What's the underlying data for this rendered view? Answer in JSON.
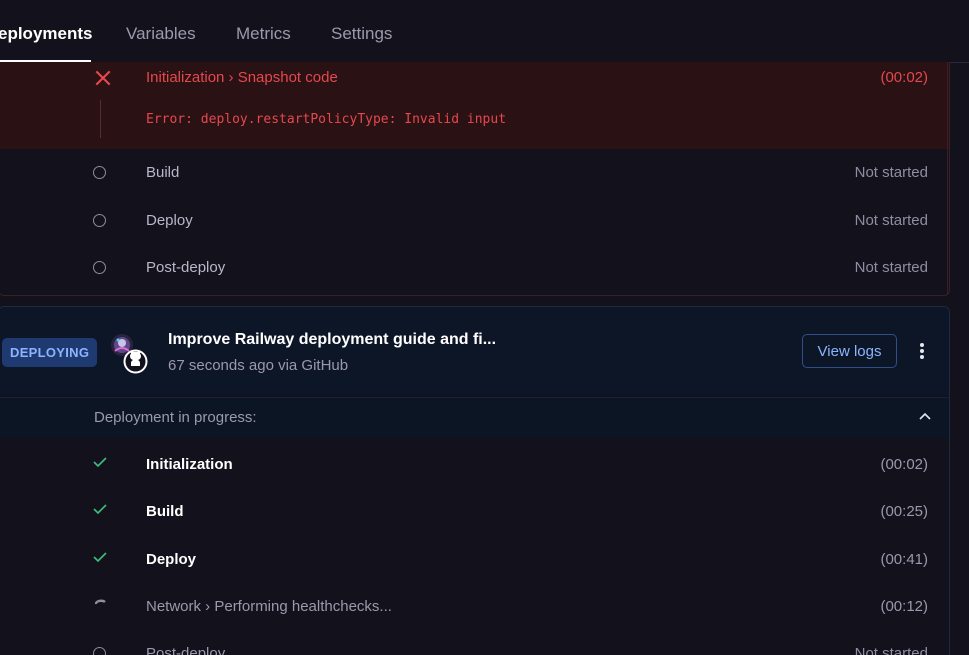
{
  "tabs": [
    {
      "label": "eployments",
      "active": true
    },
    {
      "label": "Variables",
      "active": false
    },
    {
      "label": "Metrics",
      "active": false
    },
    {
      "label": "Settings",
      "active": false
    }
  ],
  "failed_deployment": {
    "error_step": {
      "label": "Initialization › Snapshot code",
      "time": "(00:02)",
      "error_text": "Error: deploy.restartPolicyType: Invalid input"
    },
    "steps": [
      {
        "label": "Build",
        "status": "Not started"
      },
      {
        "label": "Deploy",
        "status": "Not started"
      },
      {
        "label": "Post-deploy",
        "status": "Not started"
      }
    ]
  },
  "active_deployment": {
    "badge": "DEPLOYING",
    "commit_title": "Improve Railway deployment guide and fi...",
    "commit_meta": "67 seconds ago via GitHub",
    "view_logs_label": "View logs",
    "progress_label": "Deployment in progress:",
    "steps": [
      {
        "label": "Initialization",
        "time": "(00:02)",
        "state": "done"
      },
      {
        "label": "Build",
        "time": "(00:25)",
        "state": "done"
      },
      {
        "label": "Deploy",
        "time": "(00:41)",
        "state": "done"
      },
      {
        "label": "Network › Performing healthchecks...",
        "time": "(00:12)",
        "state": "running"
      },
      {
        "label": "Post-deploy",
        "time": "Not started",
        "state": "pending"
      }
    ]
  },
  "colors": {
    "error_red": "#e5484d",
    "success_green": "#3fbf7f",
    "accent_blue": "#8cb4ff",
    "muted": "#8f8da0"
  }
}
